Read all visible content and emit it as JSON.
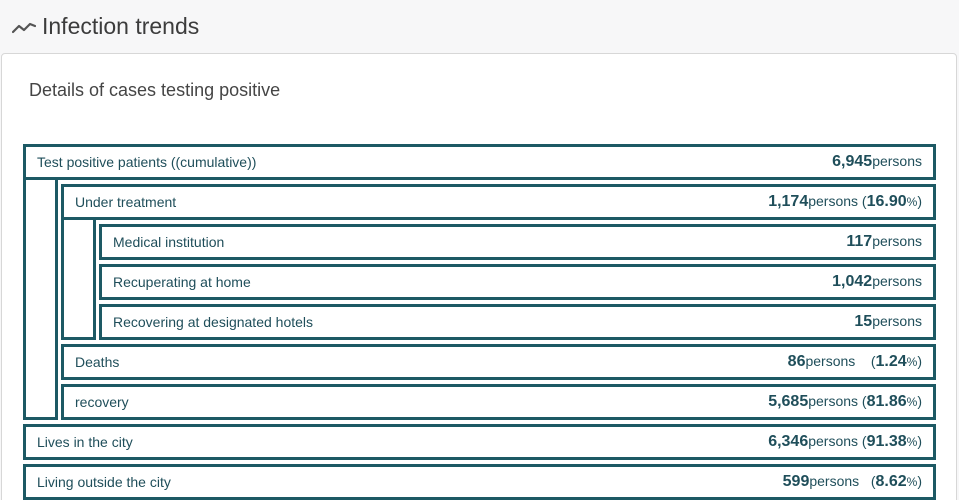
{
  "header": {
    "title": "Infection trends",
    "icon": "trend-line-icon"
  },
  "card": {
    "title": "Details of cases testing positive"
  },
  "rows": {
    "total": {
      "label": "Test positive patients ((cumulative))",
      "value": "6,945",
      "unit": "persons"
    },
    "treatment": {
      "label": "Under treatment",
      "value": "1,174",
      "unit": "persons",
      "pct": "16.90",
      "pct_unit": "%"
    },
    "medical": {
      "label": "Medical institution",
      "value": "117",
      "unit": "persons"
    },
    "home": {
      "label": "Recuperating at home",
      "value": "1,042",
      "unit": "persons"
    },
    "hotels": {
      "label": "Recovering at designated hotels",
      "value": "15",
      "unit": "persons"
    },
    "deaths": {
      "label": "Deaths",
      "value": "86",
      "unit": "persons",
      "pct": "1.24",
      "pct_unit": "%"
    },
    "recovery": {
      "label": "recovery",
      "value": "5,685",
      "unit": "persons",
      "pct": "81.86",
      "pct_unit": "%"
    },
    "city": {
      "label": "Lives in the city",
      "value": "6,346",
      "unit": "persons",
      "pct": "91.38",
      "pct_unit": "%"
    },
    "outside": {
      "label": "Living outside the city",
      "value": "599",
      "unit": "persons",
      "pct": "8.62",
      "pct_unit": "%"
    }
  },
  "colors": {
    "border": "#1d5964",
    "text": "#1f4e5a"
  }
}
